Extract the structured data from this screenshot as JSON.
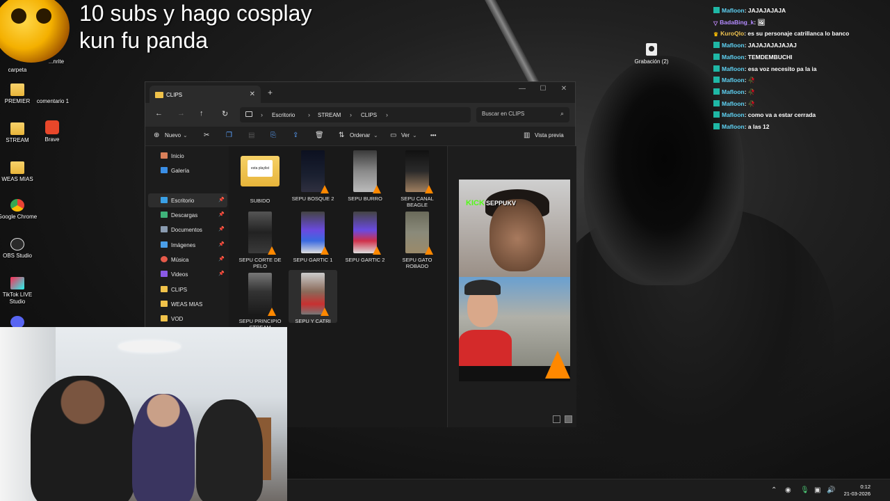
{
  "overlay": {
    "title_line1": "10 subs y hago cosplay",
    "title_line2": "kun fu panda"
  },
  "desktop_icons": [
    {
      "label": "carpeta",
      "icon": "folder-icon"
    },
    {
      "label": "...nrite",
      "icon": "file-icon"
    },
    {
      "label": "PREMIER",
      "icon": "folder-icon"
    },
    {
      "label": "comentario 1",
      "icon": "file-icon"
    },
    {
      "label": "STREAM",
      "icon": "folder-icon"
    },
    {
      "label": "Brave",
      "icon": "brave-icon"
    },
    {
      "label": "WEAS MIAS",
      "icon": "folder-icon"
    },
    {
      "label": "Google Chrome",
      "icon": "chrome-icon"
    },
    {
      "label": "OBS Studio",
      "icon": "obs-icon"
    },
    {
      "label": "TikTok LIVE Studio",
      "icon": "tiktok-icon"
    },
    {
      "label": "",
      "icon": "discord-icon"
    }
  ],
  "desktop_right_file": {
    "label": "Grabación (2)",
    "icon": "video-file-icon"
  },
  "explorer": {
    "tab_title": "CLIPS",
    "new_tab": "+",
    "window_controls": {
      "minimize": "—",
      "maximize": "☐",
      "close": "✕"
    },
    "breadcrumb": [
      "Escritorio",
      "STREAM",
      "CLIPS"
    ],
    "search_placeholder": "Buscar en CLIPS",
    "commands": {
      "new": "Nuevo",
      "sort": "Ordenar",
      "view": "Ver",
      "more": "•••",
      "preview": "Vista previa"
    },
    "sidebar": [
      {
        "label": "Inicio",
        "icon": "home-icon",
        "pinned": false
      },
      {
        "label": "Galería",
        "icon": "gallery-icon",
        "pinned": false
      },
      {
        "label": "Escritorio",
        "icon": "desktop-icon",
        "pinned": true
      },
      {
        "label": "Descargas",
        "icon": "download-icon",
        "pinned": true
      },
      {
        "label": "Documentos",
        "icon": "documents-icon",
        "pinned": true
      },
      {
        "label": "Imágenes",
        "icon": "images-icon",
        "pinned": true
      },
      {
        "label": "Música",
        "icon": "music-icon",
        "pinned": true
      },
      {
        "label": "Videos",
        "icon": "videos-icon",
        "pinned": true
      },
      {
        "label": "CLIPS",
        "icon": "folder-icon",
        "pinned": false
      },
      {
        "label": "WEAS MIAS",
        "icon": "folder-icon",
        "pinned": false
      },
      {
        "label": "VOD",
        "icon": "folder-icon",
        "pinned": false
      }
    ],
    "files": [
      {
        "name": "SUBIDO",
        "type": "folder",
        "folder_text": "esta playlist"
      },
      {
        "name": "SEPU BOSQUE 2",
        "type": "video"
      },
      {
        "name": "SEPU BURRO",
        "type": "video"
      },
      {
        "name": "SEPU CANAL BEAGLE",
        "type": "video"
      },
      {
        "name": "SEPU CORTE DE PELO",
        "type": "video"
      },
      {
        "name": "SEPU GARTIC 1",
        "type": "video"
      },
      {
        "name": "SEPU GARTIC 2",
        "type": "video"
      },
      {
        "name": "SEPU GATO ROBADO",
        "type": "video"
      },
      {
        "name": "SEPU PRINCIPIO STREAM",
        "type": "video"
      },
      {
        "name": "SEPU Y CATRI",
        "type": "video",
        "selected": true
      }
    ],
    "preview": {
      "kick_logo": "KICK",
      "channel": "SEPPUKV"
    }
  },
  "chat": [
    {
      "user": "Mafloon",
      "message": "JAJAJAJAJA",
      "badge": "sub"
    },
    {
      "user": "BadaBing_k",
      "message": "🖼",
      "badge": "vip"
    },
    {
      "user": "KuroQlo",
      "message": "es su personaje catrillanca lo banco",
      "badge": "crown"
    },
    {
      "user": "Mafloon",
      "message": "JAJAJAJAJAJAJ",
      "badge": "sub"
    },
    {
      "user": "Mafloon",
      "message": "TEMDEMBUCHI",
      "badge": "sub"
    },
    {
      "user": "Mafloon",
      "message": "esa voz necesito pa la ia",
      "badge": "sub"
    },
    {
      "user": "Mafloon",
      "message": "🥀",
      "badge": "sub"
    },
    {
      "user": "Mafloon",
      "message": "🥀",
      "badge": "sub"
    },
    {
      "user": "Mafloon",
      "message": "🥀",
      "badge": "sub"
    },
    {
      "user": "Mafloon",
      "message": "como va a estar cerrada",
      "badge": "sub"
    },
    {
      "user": "Mafloon",
      "message": "a las 12",
      "badge": "sub"
    }
  ],
  "taskbar": {
    "time": "0:12",
    "date": "21-03-2026"
  }
}
